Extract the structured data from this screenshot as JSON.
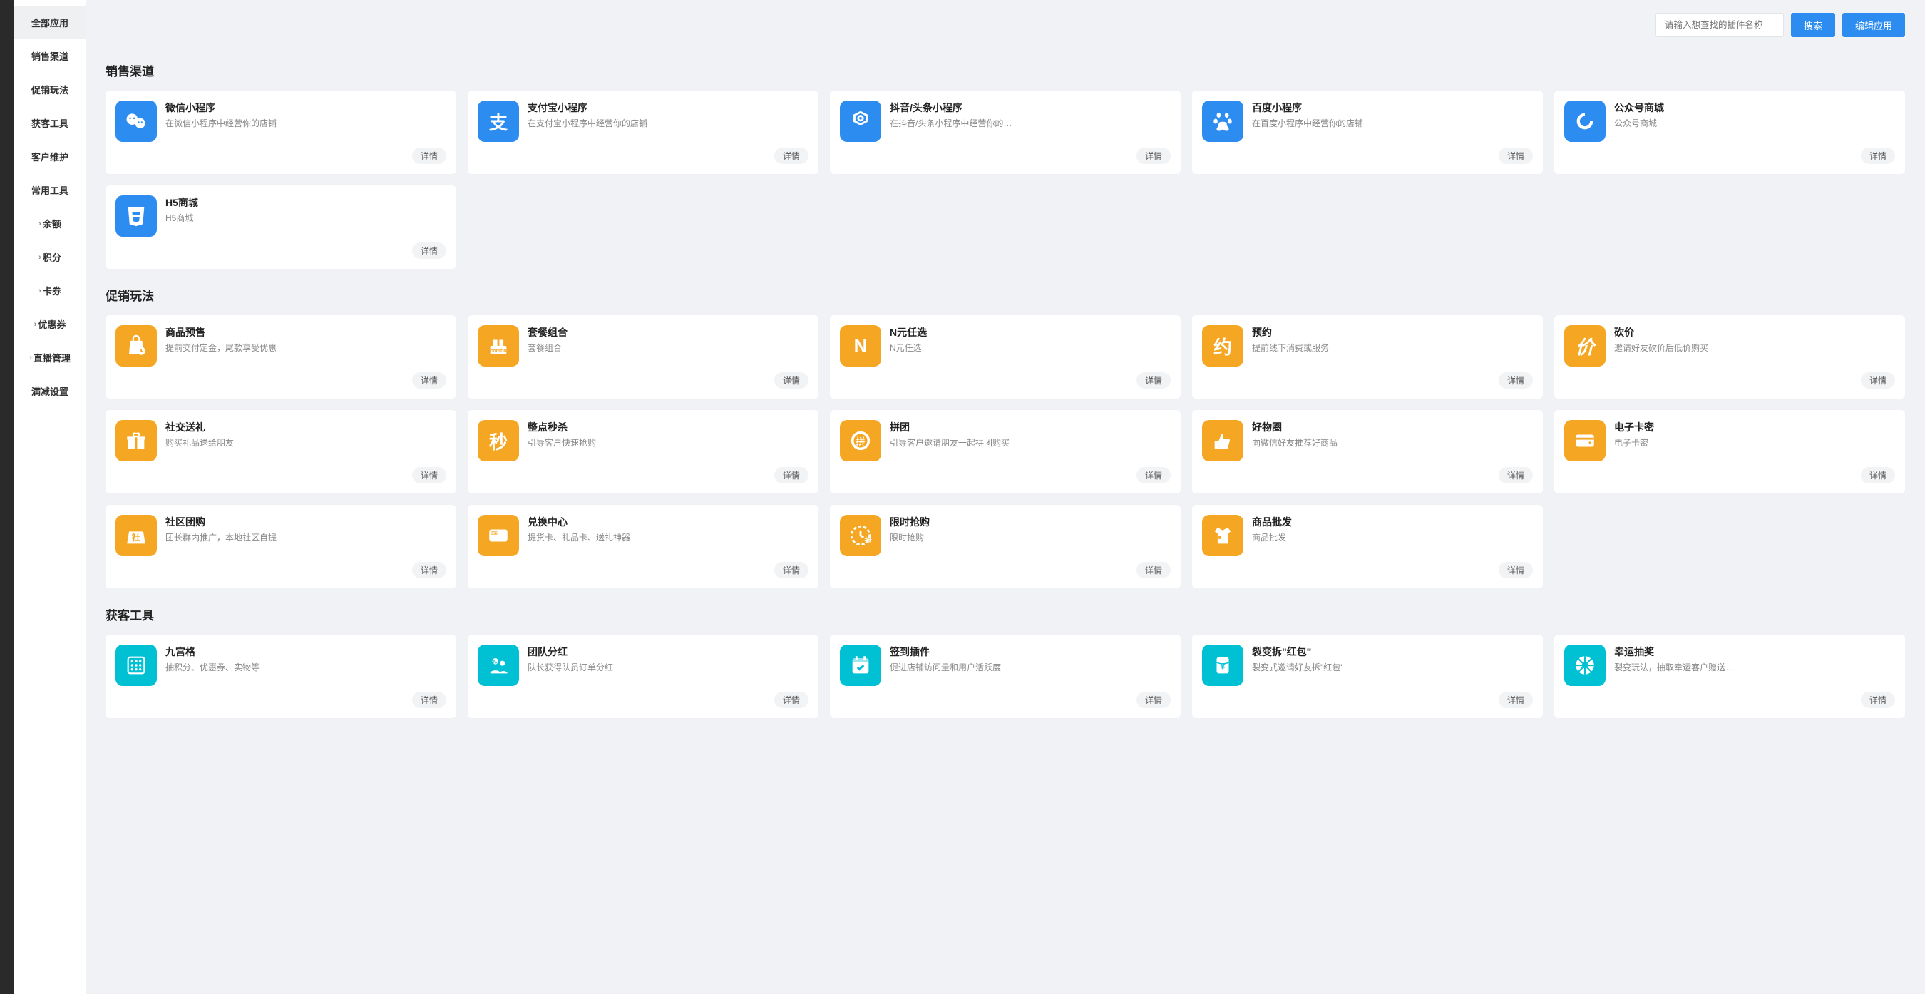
{
  "search": {
    "placeholder": "请输入想查找的插件名称",
    "search_btn": "搜索",
    "edit_btn": "编辑应用"
  },
  "detail_label": "详情",
  "sidebar": [
    {
      "label": "全部应用",
      "active": true,
      "expandable": false
    },
    {
      "label": "销售渠道",
      "active": false,
      "expandable": false
    },
    {
      "label": "促销玩法",
      "active": false,
      "expandable": false
    },
    {
      "label": "获客工具",
      "active": false,
      "expandable": false
    },
    {
      "label": "客户维护",
      "active": false,
      "expandable": false
    },
    {
      "label": "常用工具",
      "active": false,
      "expandable": false
    },
    {
      "label": "余额",
      "active": false,
      "expandable": true
    },
    {
      "label": "积分",
      "active": false,
      "expandable": true
    },
    {
      "label": "卡券",
      "active": false,
      "expandable": true
    },
    {
      "label": "优惠券",
      "active": false,
      "expandable": true
    },
    {
      "label": "直播管理",
      "active": false,
      "expandable": true
    },
    {
      "label": "满减设置",
      "active": false,
      "expandable": false
    }
  ],
  "sections": [
    {
      "title": "销售渠道",
      "cards": [
        {
          "title": "微信小程序",
          "desc": "在微信小程序中经营你的店铺",
          "icon": "wechat",
          "color": "ic-blue"
        },
        {
          "title": "支付宝小程序",
          "desc": "在支付宝小程序中经营你的店铺",
          "icon": "alipay",
          "color": "ic-blue"
        },
        {
          "title": "抖音/头条小程序",
          "desc": "在抖音/头条小程序中经营你的…",
          "icon": "douyin",
          "color": "ic-blue"
        },
        {
          "title": "百度小程序",
          "desc": "在百度小程序中经营你的店铺",
          "icon": "baidu",
          "color": "ic-blue"
        },
        {
          "title": "公众号商城",
          "desc": "公众号商城",
          "icon": "loop",
          "color": "ic-blue"
        },
        {
          "title": "H5商城",
          "desc": "H5商城",
          "icon": "html5",
          "color": "ic-blue"
        }
      ]
    },
    {
      "title": "促销玩法",
      "cards": [
        {
          "title": "商品预售",
          "desc": "提前交付定金，尾款享受优惠",
          "icon": "bag-clock",
          "color": "ic-orange"
        },
        {
          "title": "套餐组合",
          "desc": "套餐组合",
          "icon": "combo",
          "color": "ic-orange"
        },
        {
          "title": "N元任选",
          "desc": "N元任选",
          "icon": "letter-n",
          "color": "ic-orange"
        },
        {
          "title": "预约",
          "desc": "提前线下消费或服务",
          "icon": "yue",
          "color": "ic-orange"
        },
        {
          "title": "砍价",
          "desc": "邀请好友砍价后低价购买",
          "icon": "jia",
          "color": "ic-orange"
        },
        {
          "title": "社交送礼",
          "desc": "购买礼品送给朋友",
          "icon": "gift",
          "color": "ic-orange"
        },
        {
          "title": "整点秒杀",
          "desc": "引导客户快速抢购",
          "icon": "miao",
          "color": "ic-orange"
        },
        {
          "title": "拼团",
          "desc": "引导客户邀请朋友一起拼团购买",
          "icon": "pin",
          "color": "ic-orange"
        },
        {
          "title": "好物圈",
          "desc": "向微信好友推荐好商品",
          "icon": "thumb",
          "color": "ic-orange"
        },
        {
          "title": "电子卡密",
          "desc": "电子卡密",
          "icon": "card-lock",
          "color": "ic-orange"
        },
        {
          "title": "社区团购",
          "desc": "团长群内推广，本地社区自提",
          "icon": "she",
          "color": "ic-orange"
        },
        {
          "title": "兑换中心",
          "desc": "提货卡、礼品卡、送礼神器",
          "icon": "gift-card",
          "color": "ic-orange"
        },
        {
          "title": "限时抢购",
          "desc": "限时抢购",
          "icon": "clock-qiang",
          "color": "ic-orange"
        },
        {
          "title": "商品批发",
          "desc": "商品批发",
          "icon": "shirt",
          "color": "ic-orange"
        }
      ]
    },
    {
      "title": "获客工具",
      "cards": [
        {
          "title": "九宫格",
          "desc": "抽积分、优惠券、实物等",
          "icon": "grid9",
          "color": "ic-teal"
        },
        {
          "title": "团队分红",
          "desc": "队长获得队员订单分红",
          "icon": "team",
          "color": "ic-teal"
        },
        {
          "title": "签到插件",
          "desc": "促进店铺访问量和用户活跃度",
          "icon": "calendar",
          "color": "ic-teal"
        },
        {
          "title": "裂变拆\"红包\"",
          "desc": "裂变式邀请好友拆\"红包\"",
          "icon": "redpack",
          "color": "ic-teal"
        },
        {
          "title": "幸运抽奖",
          "desc": "裂变玩法，抽取幸运客户赠送…",
          "icon": "wheel",
          "color": "ic-teal"
        }
      ]
    }
  ]
}
